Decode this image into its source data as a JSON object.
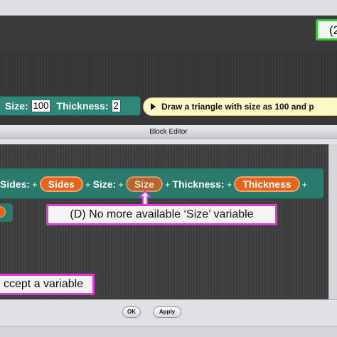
{
  "top_callout": {
    "text": "(2"
  },
  "command_block": {
    "size_label": "Size:",
    "size_value": "100",
    "thickness_label": "Thickness:",
    "thickness_value": "2"
  },
  "tooltip": {
    "text": "Draw a triangle with size as 100 and p"
  },
  "editor": {
    "title": "Block Editor",
    "definition": {
      "sides_label": "Sides:",
      "sides_param": "Sides",
      "size_label": "Size:",
      "size_param": "Size",
      "thickness_label": "Thickness:",
      "thickness_param": "Thickness",
      "plus": "+"
    },
    "ok_label": "OK",
    "apply_label": "Apply"
  },
  "callout_d": {
    "text": "(D) No more available ‘Size’ variable"
  },
  "callout_left": {
    "text": "ccept a variable"
  },
  "colors": {
    "block_green": "#2a7a6d",
    "param_orange": "#e3651d",
    "callout_magenta": "#e23ad8",
    "callout_green": "#34c834",
    "tooltip_yellow": "#fcf9c6"
  }
}
